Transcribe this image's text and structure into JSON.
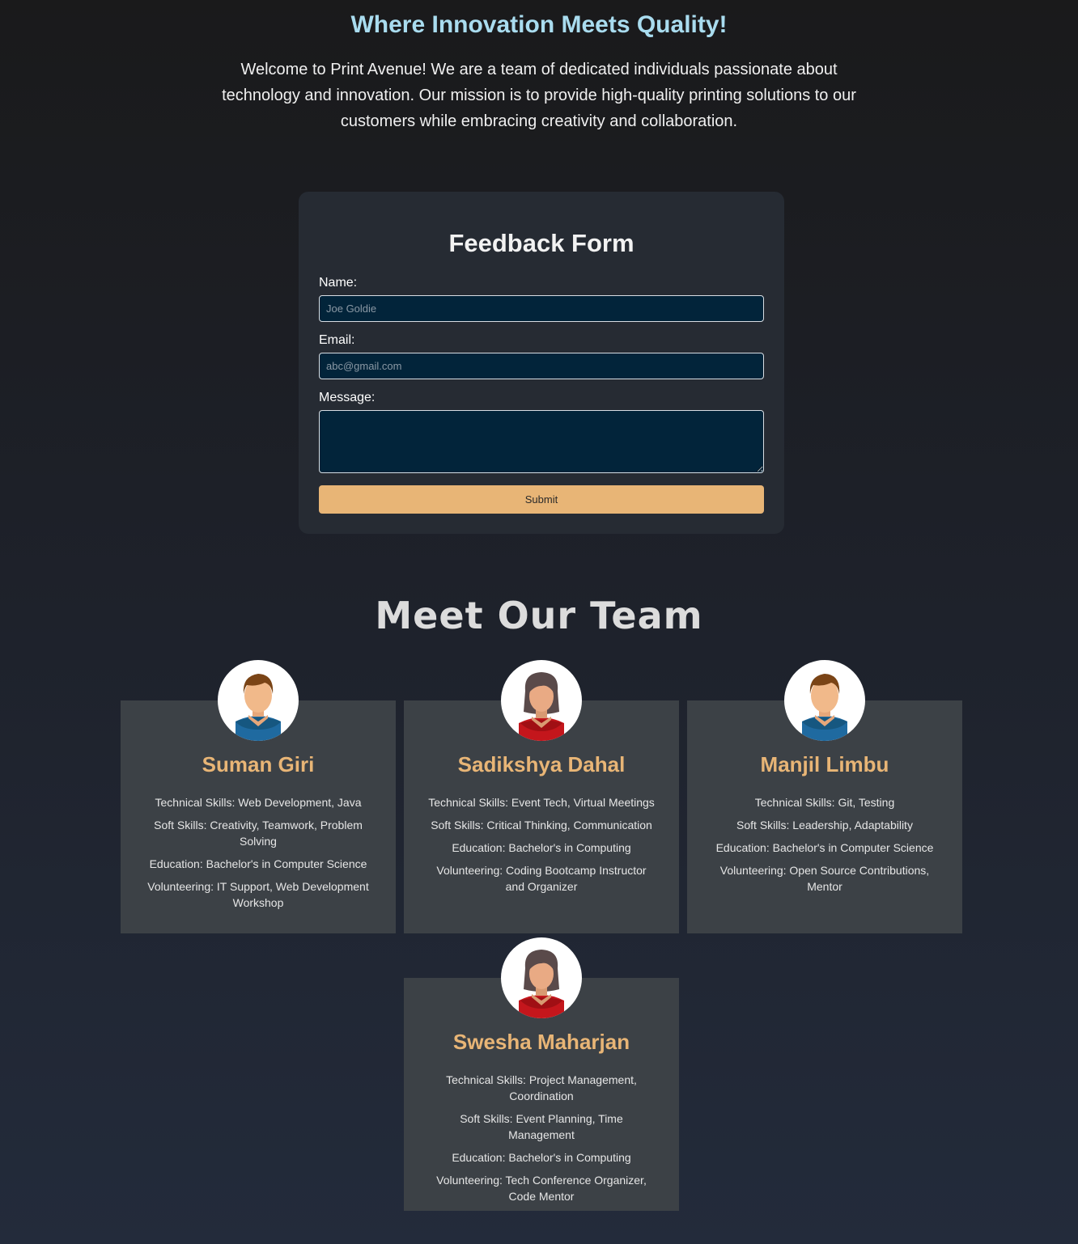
{
  "hero": {
    "title": "Where Innovation Meets Quality!",
    "text": "Welcome to Print Avenue! We are a team of dedicated individuals passionate about technology and innovation. Our mission is to provide high-quality printing solutions to our customers while embracing creativity and collaboration."
  },
  "form": {
    "title": "Feedback Form",
    "name_label": "Name:",
    "name_placeholder": "Joe Goldie",
    "name_value": "",
    "email_label": "Email:",
    "email_placeholder": "abc@gmail.com",
    "email_value": "",
    "message_label": "Message:",
    "message_value": "",
    "submit_label": "Submit"
  },
  "team": {
    "title": "Meet Our Team",
    "members": [
      {
        "name": "Suman Giri",
        "avatar_icon": "male-avatar-icon",
        "technical": "Technical Skills: Web Development, Java",
        "soft": "Soft Skills: Creativity, Teamwork, Problem Solving",
        "education": "Education: Bachelor's in Computer Science",
        "volunteering": "Volunteering: IT Support, Web Development Workshop"
      },
      {
        "name": "Sadikshya Dahal",
        "avatar_icon": "female-avatar-icon",
        "technical": "Technical Skills: Event Tech, Virtual Meetings",
        "soft": "Soft Skills: Critical Thinking, Communication",
        "education": "Education: Bachelor's in Computing",
        "volunteering": "Volunteering: Coding Bootcamp Instructor and Organizer"
      },
      {
        "name": "Manjil Limbu",
        "avatar_icon": "male-avatar-icon",
        "technical": "Technical Skills: Git, Testing",
        "soft": "Soft Skills: Leadership, Adaptability",
        "education": "Education: Bachelor's in Computer Science",
        "volunteering": "Volunteering: Open Source Contributions, Mentor"
      },
      {
        "name": "Swesha Maharjan",
        "avatar_icon": "female-avatar-icon",
        "technical": "Technical Skills: Project Management, Coordination",
        "soft": "Soft Skills: Event Planning, Time Management",
        "education": "Education: Bachelor's in Computing",
        "volunteering": "Volunteering: Tech Conference Organizer, Code Mentor"
      }
    ]
  },
  "colors": {
    "title_blue": "#a9dcef",
    "accent_orange": "#e8b576",
    "card_bg": "#3c4146",
    "form_bg": "#262b33",
    "input_bg": "#02243a"
  }
}
